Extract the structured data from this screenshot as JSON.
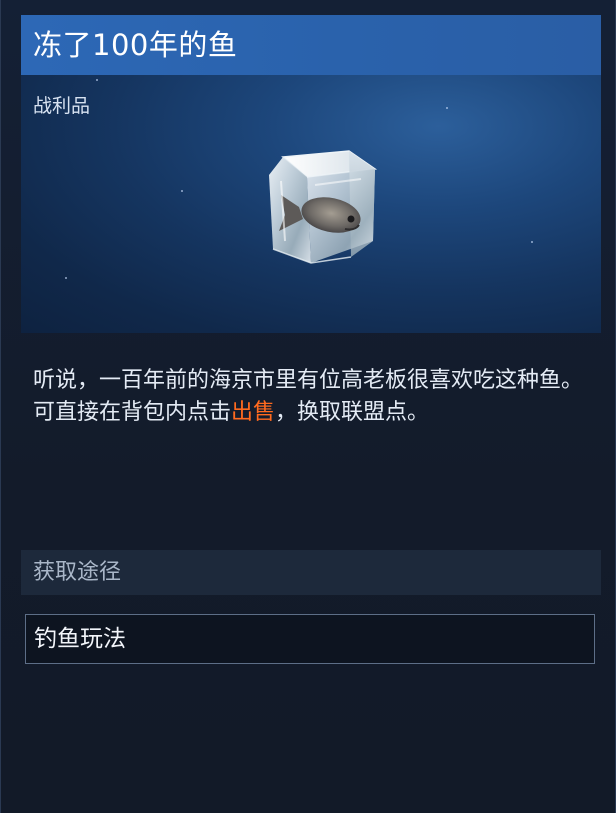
{
  "item": {
    "name": "冻了100年的鱼",
    "category": "战利品",
    "image_icon": "frozen-fish-in-ice-cube"
  },
  "description": {
    "line1": "听说，一百年前的海京市里有位高老板很喜欢吃这种鱼。",
    "line2_before": "可直接在背包内点击",
    "line2_highlight": "出售",
    "line2_after": "，换取联盟点。",
    "highlight_color": "#ff6a1f"
  },
  "acquisition": {
    "header": "获取途径",
    "sources": [
      "钓鱼玩法"
    ]
  },
  "colors": {
    "title_bar": "#2d68b6",
    "background": "#131c2b"
  }
}
